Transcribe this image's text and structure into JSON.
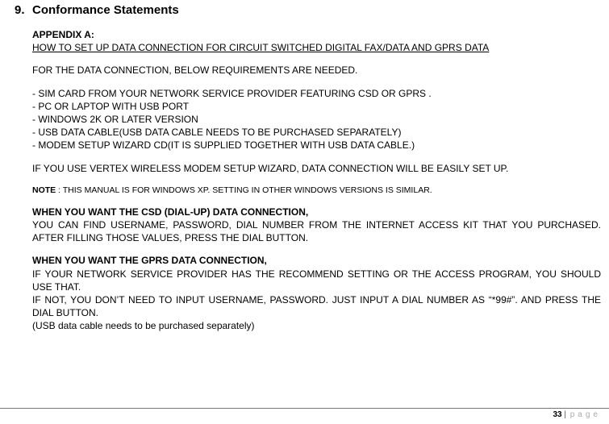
{
  "heading": {
    "num": "9.",
    "title": "Conformance Statements"
  },
  "appendix": {
    "label": "APPENDIX A:",
    "title": "HOW TO SET UP DATA CONNECTION FOR CIRCUIT SWITCHED DIGITAL FAX/DATA AND GPRS DATA"
  },
  "intro": "FOR THE DATA CONNECTION, BELOW REQUIREMENTS ARE NEEDED.",
  "reqs": [
    "- SIM CARD FROM YOUR NETWORK SERVICE PROVIDER FEATURING CSD OR GPRS .",
    "- PC OR LAPTOP WITH USB PORT",
    "- WINDOWS 2K OR LATER VERSION",
    "- USB DATA CABLE(USB DATA CABLE NEEDS TO BE PURCHASED SEPARATELY)",
    "- MODEM SETUP WIZARD CD(IT IS SUPPLIED TOGETHER WITH USB DATA CABLE.)"
  ],
  "wizard": "IF YOU USE VERTEX WIRELESS MODEM SETUP WIZARD, DATA CONNECTION WILL BE EASILY SET UP.",
  "note": {
    "label": "NOTE",
    "text": " : THIS MANUAL IS FOR WINDOWS XP. SETTING IN OTHER WINDOWS VERSIONS IS SIMILAR."
  },
  "csd": {
    "title": "WHEN YOU WANT THE CSD (DIAL-UP) DATA CONNECTION,",
    "body": "YOU CAN FIND USERNAME, PASSWORD, DIAL NUMBER FROM THE INTERNET ACCESS KIT THAT YOU PURCHASED. AFTER FILLING THOSE VALUES, PRESS THE DIAL BUTTON."
  },
  "gprs": {
    "title": "WHEN YOU WANT THE GPRS DATA CONNECTION,",
    "l1": "IF YOUR NETWORK SERVICE PROVIDER HAS THE RECOMMEND SETTING OR THE ACCESS PROGRAM, YOU SHOULD USE THAT.",
    "l2": "IF NOT, YOU DON’T NEED TO INPUT USERNAME, PASSWORD. JUST INPUT A DIAL NUMBER AS “*99#”. AND PRESS THE DIAL BUTTON.",
    "l3": "(USB data cable needs to be purchased separately)"
  },
  "footer": {
    "num": "33",
    "sep": " | ",
    "word": "page"
  }
}
